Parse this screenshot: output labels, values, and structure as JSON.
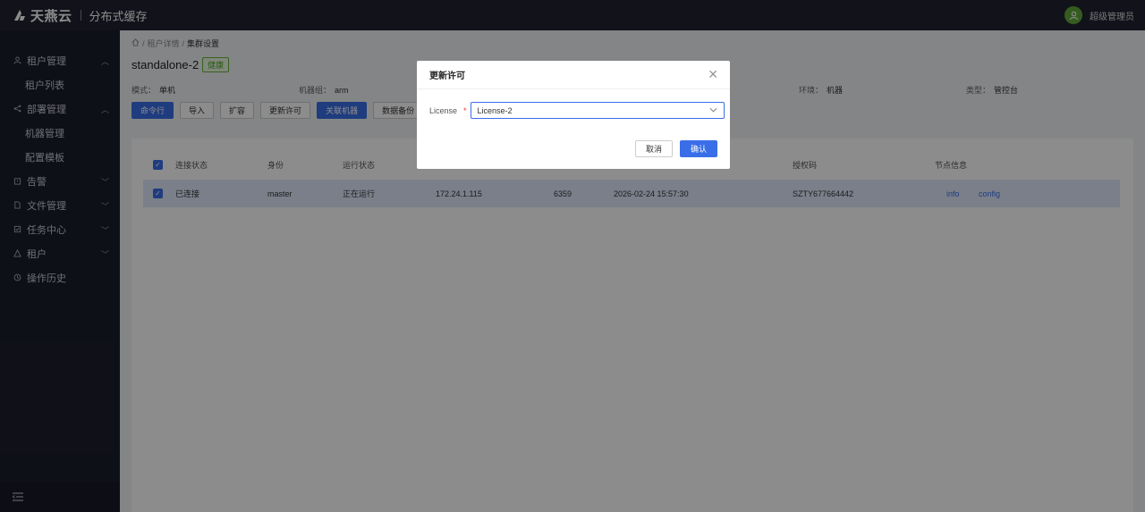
{
  "topbar": {
    "brand": "天燕云",
    "product": "分布式缓存",
    "user": "超级管理员",
    "icons": [
      "logo-icon",
      "user-avatar-icon"
    ]
  },
  "sidebar": {
    "items": [
      {
        "label": "租户管理",
        "icon": "user-icon",
        "expanded": true,
        "children": [
          {
            "label": "租户列表"
          }
        ]
      },
      {
        "label": "部署管理",
        "icon": "share-icon",
        "expanded": true,
        "children": [
          {
            "label": "机器管理"
          },
          {
            "label": "配置模板"
          }
        ]
      },
      {
        "label": "告警",
        "icon": "alarm-icon",
        "expanded": false
      },
      {
        "label": "文件管理",
        "icon": "file-icon",
        "expanded": false
      },
      {
        "label": "任务中心",
        "icon": "task-icon",
        "expanded": false
      },
      {
        "label": "租户",
        "icon": "tenant-icon",
        "expanded": false
      },
      {
        "label": "操作历史",
        "icon": "history-icon"
      }
    ],
    "collapse_icon": "menu-fold-icon"
  },
  "breadcrumb": {
    "items": [
      "租户详情",
      "集群设置"
    ]
  },
  "page": {
    "title": "standalone-2",
    "status": "健康",
    "info": [
      {
        "label": "模式：",
        "value": "单机"
      },
      {
        "label": "机器组：",
        "value": "arm"
      },
      {
        "label": "环境：",
        "value": "机器"
      },
      {
        "label": "类型：",
        "value": "管控台"
      }
    ]
  },
  "toolbar": {
    "buttons": [
      "命令行",
      "导入",
      "扩容",
      "更新许可",
      "关联机器",
      "数据备份"
    ]
  },
  "table": {
    "headers": [
      "连接状态",
      "身份",
      "运行状态",
      "授权码",
      "节点信息"
    ],
    "rows": [
      {
        "conn": "已连接",
        "role": "master",
        "run": "正在运行",
        "ip": "172.24.1.115",
        "port": "6359",
        "time": "2026-02-24 15:57:30",
        "code": "SZTY677664442",
        "links": [
          "info",
          "config"
        ]
      }
    ]
  },
  "modal": {
    "title": "更新许可",
    "field_label": "License",
    "required_mark": "*",
    "selected": "License-2",
    "cancel": "取消",
    "ok": "确认"
  },
  "colors": {
    "primary": "#3a6ee8",
    "success": "#52a52d",
    "sidebar": "#1b1e2b"
  }
}
